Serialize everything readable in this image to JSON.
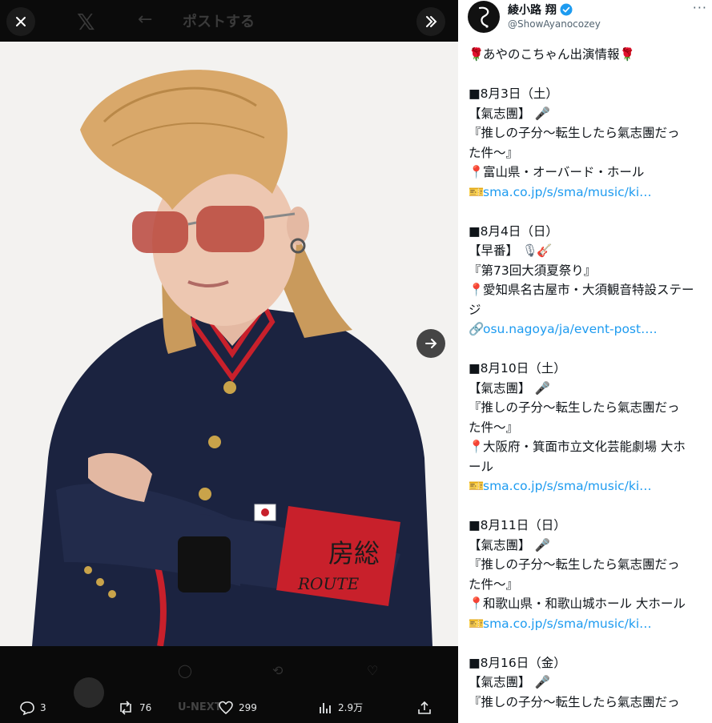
{
  "media": {
    "header_icon": "x-logo-icon",
    "header_title": "ポストする",
    "buttons": {
      "close": "close-icon",
      "expand": "expand-icon",
      "next": "arrow-right-icon"
    },
    "armband_text_jp": "房総",
    "armband_text_en": "ROUTE",
    "ghost_footer_text": "U-NEXT"
  },
  "actions": {
    "replies": "3",
    "reposts": "76",
    "likes": "299",
    "views": "2.9万"
  },
  "tweet": {
    "display_name": "綾小路 翔",
    "handle": "@ShowAyanocozey",
    "lines": [
      "あやのこちゃん出演情報",
      "",
      "■8月3日（土）",
      "【氣志團】",
      "『推しの子分～転生したら氣志團だっ",
      "た件～』",
      "富山県・オーバード・ホール",
      "sma.co.jp/s/sma/music/ki…",
      "",
      "■8月4日（日）",
      "【早番】",
      "『第73回大須夏祭り』",
      "愛知県名古屋市・大須観音特設ステー",
      "ジ",
      "osu.nagoya/ja/event-post….",
      "",
      "■8月10日（土）",
      "【氣志團】",
      "『推しの子分～転生したら氣志團だっ",
      "た件～』",
      "大阪府・箕面市立文化芸能劇場 大ホ",
      "ール",
      "sma.co.jp/s/sma/music/ki…",
      "",
      "■8月11日（日）",
      "【氣志團】",
      "『推しの子分～転生したら氣志團だっ",
      "た件～』",
      "和歌山県・和歌山城ホール 大ホール",
      "sma.co.jp/s/sma/music/ki…",
      "",
      "■8月16日（金）",
      "【氣志團】",
      "『推しの子分～転生したら氣志團だっ"
    ]
  },
  "colors": {
    "accent": "#1d9bf0",
    "text": "#0f1419",
    "muted": "#536471",
    "jacket": "#1b2340",
    "trim": "#c8202b",
    "hair": "#d9a86a"
  }
}
